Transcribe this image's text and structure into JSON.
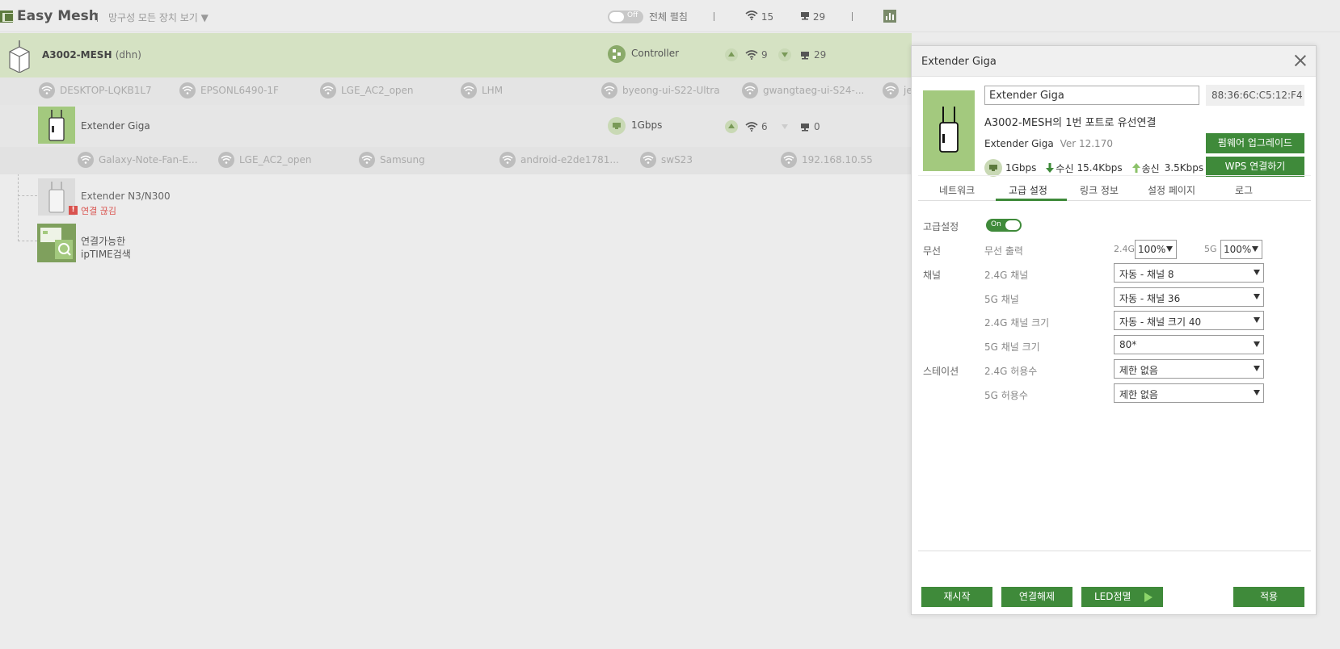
{
  "topbar": {
    "app_title": "Easy Mesh",
    "view_all": "망구성 모든 장치 보기 ▼",
    "toggle_label": "Off",
    "expand_all": "전체 펼침",
    "wifi_count": "15",
    "pc_count": "29"
  },
  "main_node": {
    "name": "A3002-MESH",
    "suffix": "(dhn)",
    "role": "Controller",
    "wifi_count": "9",
    "pc_count": "29"
  },
  "clients_row1": [
    "DESKTOP-LQKB1L7",
    "EPSONL6490-1F",
    "LGE_AC2_open",
    "LHM",
    "byeong-ui-S22-Ultra",
    "gwangtaeg-ui-S24-...",
    "je"
  ],
  "extender_node": {
    "name": "Extender Giga",
    "link": "1Gbps",
    "wifi_count": "6",
    "pc_count": "0"
  },
  "clients_row2": [
    "Galaxy-Note-Fan-E...",
    "LGE_AC2_open",
    "Samsung",
    "android-e2de1781...",
    "swS23",
    "192.168.10.55"
  ],
  "extender2": {
    "name": "Extender N3/N300",
    "status": "연결 끊김"
  },
  "search_node": {
    "line1": "연결가능한",
    "line2": "ipTIME검색"
  },
  "panel": {
    "title": "Extender Giga",
    "name_value": "Extender Giga",
    "mac": "88:36:6C:C5:12:F4",
    "connection": "A3002-MESH의 1번 포트로 유선연결",
    "model": "Extender Giga",
    "version": "Ver 12.170",
    "link_speed": "1Gbps",
    "rx_label": "수신",
    "rx_value": "15.4Kbps",
    "tx_label": "송신",
    "tx_value": "3.5Kbps",
    "firmware_btn": "펌웨어 업그레이드",
    "wps_btn": "WPS 연결하기",
    "tabs": [
      "네트워크",
      "고급 설정",
      "링크 정보",
      "설정 페이지",
      "로그"
    ],
    "active_tab": "고급 설정",
    "advanced_label": "고급설정",
    "advanced_toggle": "On",
    "wireless_label": "무선",
    "wireless_output": "무선 출력",
    "band24": "2.4G",
    "power24": "100%",
    "band5": "5G",
    "power5": "100%",
    "channel_label": "채널",
    "ch24_label": "2.4G 채널",
    "ch24_value": "자동 - 채널 8",
    "ch5_label": "5G 채널",
    "ch5_value": "자동 - 채널 36",
    "bw24_label": "2.4G 채널 크기",
    "bw24_value": "자동 - 채널 크기 40",
    "bw5_label": "5G 채널 크기",
    "bw5_value": "80*",
    "station_label": "스테이션",
    "sta24_label": "2.4G 허용수",
    "sta24_value": "제한 없음",
    "sta5_label": "5G 허용수",
    "sta5_value": "제한 없음",
    "btn_restart": "재시작",
    "btn_disconnect": "연결해제",
    "btn_led": "LED점멸",
    "btn_apply": "적용"
  },
  "colors": {
    "accent_green": "#3f8a3a",
    "row_highlight": "#d5e2c3",
    "device_green": "#a3c97e",
    "error_red": "#d9534f"
  }
}
